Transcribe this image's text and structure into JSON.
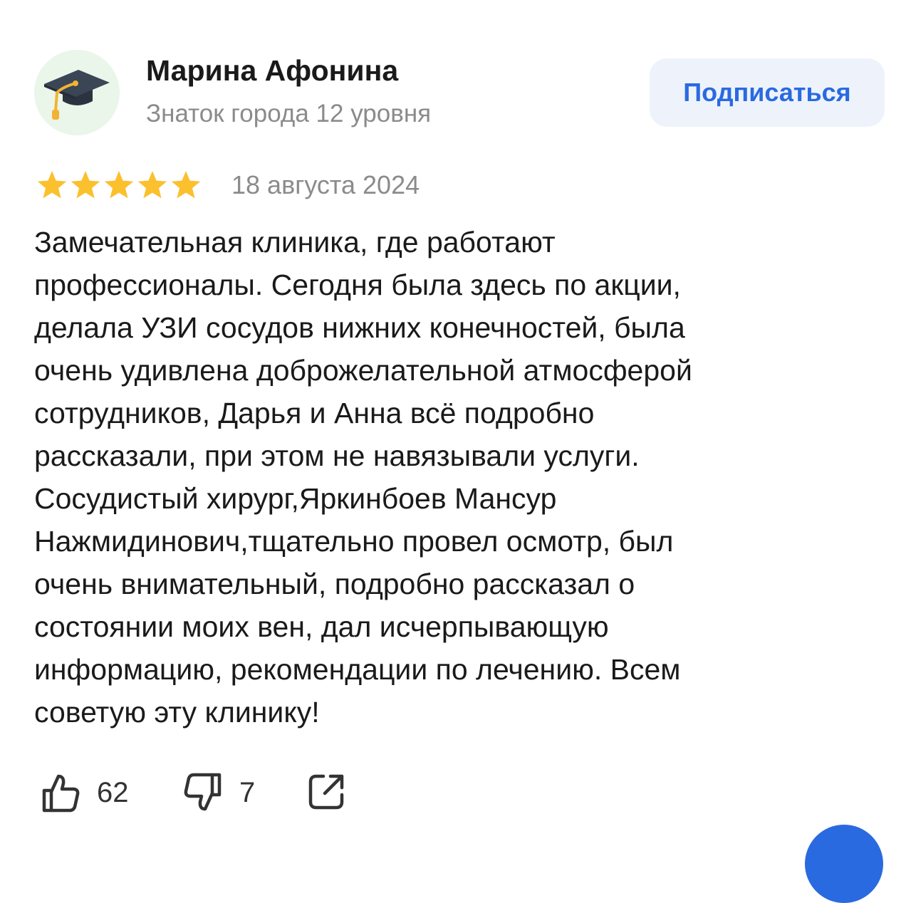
{
  "author": {
    "name": "Марина Афонина",
    "level": "Знаток города 12 уровня",
    "avatar_icon": "graduation-cap-icon"
  },
  "subscribe_label": "Подписаться",
  "review": {
    "rating": 5,
    "rating_max": 5,
    "date": "18 августа 2024",
    "text_lines": [
      "Замечательная клиника, где работают",
      "профессионалы. Сегодня была здесь по акции,",
      "делала УЗИ сосудов нижних конечностей, была",
      "очень удивлена доброжелательной атмосферой",
      "сотрудников, Дарья и Анна всё подробно",
      "рассказали, при этом не навязывали услуги.",
      "Сосудистый хирург,Яркинбоев Мансур",
      "Нажмидинович,тщательно провел осмотр, был",
      "очень внимательный, подробно рассказал о",
      "состоянии моих вен, дал исчерпывающую",
      "информацию, рекомендации по лечению. Всем",
      "советую эту клинику!"
    ]
  },
  "actions": {
    "likes": "62",
    "dislikes": "7",
    "like_icon": "thumbs-up-icon",
    "dislike_icon": "thumbs-down-icon",
    "share_icon": "share-icon"
  },
  "colors": {
    "accent": "#2a6ae0",
    "star": "#fbc02d",
    "muted_text": "#8b8b8b",
    "avatar_bg": "#e9f6e9",
    "button_bg": "#eef3fb"
  }
}
